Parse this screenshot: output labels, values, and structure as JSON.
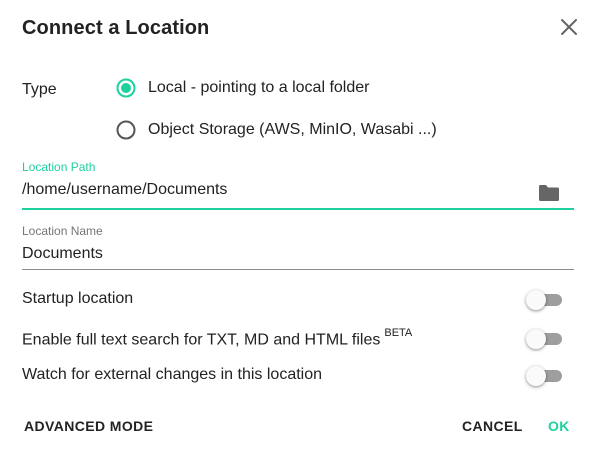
{
  "dialog": {
    "title": "Connect a Location",
    "close_icon": "close-icon"
  },
  "type": {
    "label": "Type",
    "options": [
      {
        "label": "Local - pointing to a local folder",
        "selected": true
      },
      {
        "label": "Object Storage (AWS, MinIO, Wasabi ...)",
        "selected": false
      }
    ]
  },
  "location_path": {
    "label": "Location Path",
    "value": "/home/username/Documents",
    "icon": "folder-icon"
  },
  "location_name": {
    "label": "Location Name",
    "value": "Documents"
  },
  "toggles": [
    {
      "label": "Startup location",
      "on": false
    },
    {
      "label": "Enable full text search for TXT, MD and HTML files",
      "badge": "BETA",
      "on": false
    },
    {
      "label": "Watch for external changes in this location",
      "on": false
    }
  ],
  "buttons": {
    "advanced": "ADVANCED MODE",
    "cancel": "CANCEL",
    "ok": "OK"
  },
  "colors": {
    "accent": "#1dd19f",
    "text": "#222222",
    "switch_off_track": "#9e9e9e"
  }
}
